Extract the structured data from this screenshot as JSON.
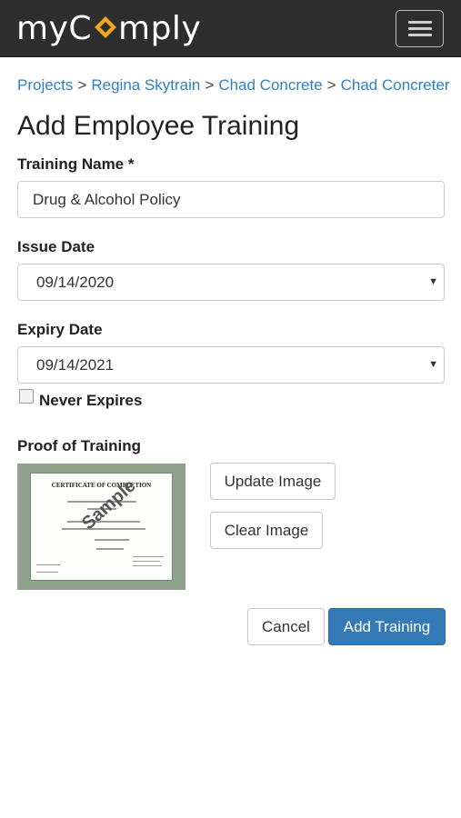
{
  "brand": {
    "name_part1": "my",
    "name_part2": "mply",
    "logo_color": "#f0a81c"
  },
  "nav": {
    "menu_icon": "hamburger-menu-icon"
  },
  "breadcrumb": {
    "items": [
      "Projects",
      "Regina Skytrain",
      "Chad Concrete",
      "Chad Concreter"
    ],
    "separator": ">"
  },
  "page": {
    "title": "Add Employee Training"
  },
  "form": {
    "training_name": {
      "label": "Training Name *",
      "value": "Drug & Alcohol Policy"
    },
    "issue_date": {
      "label": "Issue Date",
      "value": "09/14/2020"
    },
    "expiry_date": {
      "label": "Expiry Date",
      "value": "09/14/2021"
    },
    "never_expires": {
      "label": "Never Expires",
      "checked": false
    },
    "proof": {
      "label": "Proof of Training",
      "update_label": "Update Image",
      "clear_label": "Clear Image"
    },
    "cancel_label": "Cancel",
    "submit_label": "Add Training"
  },
  "certificate": {
    "title": "CERTIFICATE OF COMPLETION",
    "watermark": "Sample"
  },
  "colors": {
    "navbar": "#2e2e2e",
    "link": "#2f7fc1",
    "primary": "#337ab7"
  }
}
